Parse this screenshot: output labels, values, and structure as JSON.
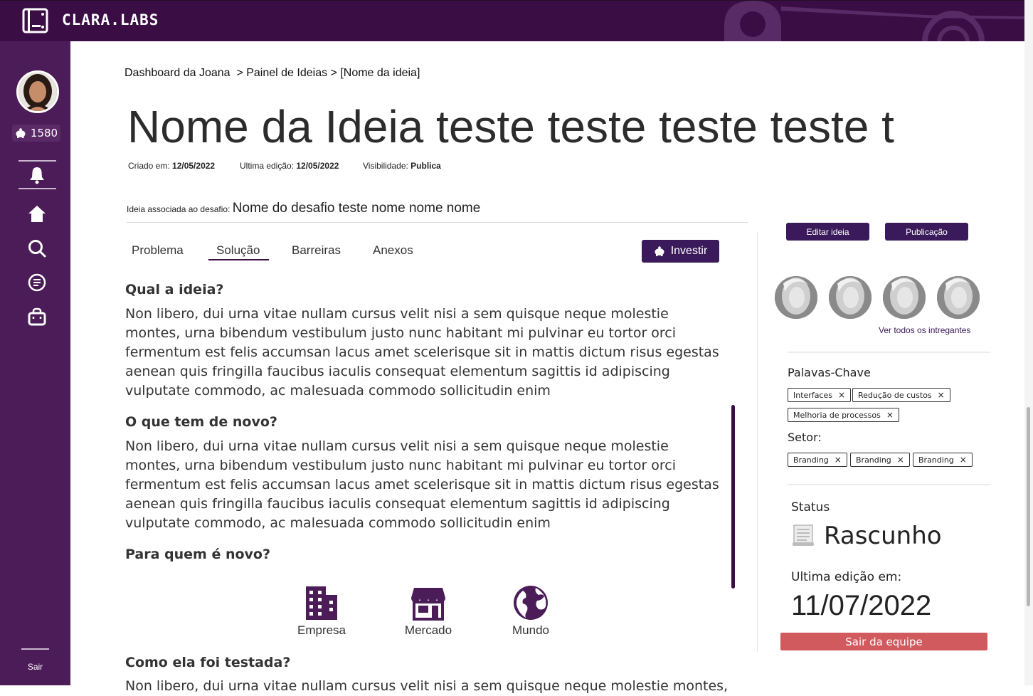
{
  "app": {
    "brand": "CLARA.LABS"
  },
  "sidebar": {
    "coins": "1580",
    "logout_label": "Sair",
    "items": [
      {
        "icon": "bell-icon"
      },
      {
        "icon": "home-icon"
      },
      {
        "icon": "search-icon"
      },
      {
        "icon": "list-icon"
      },
      {
        "icon": "bag-icon"
      }
    ]
  },
  "breadcrumb": "Dashboard da Joana  > Painel de Ideias > [Nome da ideia]",
  "idea": {
    "title": "Nome da Ideia teste teste teste teste t",
    "created_label": "Criado em: ",
    "created_value": "12/05/2022",
    "edited_label": "Ultima edição: ",
    "edited_value": "12/05/2022",
    "visibility_label": "Visibilidade: ",
    "visibility_value": "Publica",
    "challenge_label": "Ideia associada ao desafio: ",
    "challenge_value": "Nome do desafio teste nome nome nome"
  },
  "tabs": [
    {
      "label": "Problema"
    },
    {
      "label": "Solução",
      "active": true
    },
    {
      "label": "Barreiras"
    },
    {
      "label": "Anexos"
    }
  ],
  "invest_label": "Investir",
  "sections": {
    "q1": "Qual a ideia?",
    "p1": "Non libero, dui urna vitae nullam cursus velit nisi a sem quisque neque molestie montes, urna bibendum vestibulum justo nunc habitant mi pulvinar eu tortor orci fermentum est felis accumsan lacus amet scelerisque sit in mattis dictum risus egestas aenean quis fringilla faucibus iaculis consequat elementum sagittis id adipiscing vulputate commodo, ac malesuada commodo sollicitudin enim",
    "q2": "O que tem de novo?",
    "p2": "Non libero, dui urna vitae nullam cursus velit nisi a sem quisque neque molestie montes, urna bibendum vestibulum justo nunc habitant mi pulvinar eu tortor orci fermentum est felis accumsan lacus amet scelerisque sit in mattis dictum risus egestas aenean quis fringilla faucibus iaculis consequat elementum sagittis id adipiscing vulputate commodo, ac malesuada commodo sollicitudin enim",
    "q3": "Para quem é novo?",
    "audience": [
      {
        "label": "Empresa",
        "icon": "building-icon"
      },
      {
        "label": "Mercado",
        "icon": "store-icon"
      },
      {
        "label": "Mundo",
        "icon": "globe-icon"
      }
    ],
    "q4": "Como ela foi testada?",
    "p4": "Non libero, dui urna vitae nullam cursus velit nisi a sem quisque neque molestie montes,"
  },
  "side": {
    "edit_button": "Editar ideia",
    "publish_button": "Publicação",
    "see_all_members": "Ver todos os intregantes",
    "keywords_title": "Palavas-Chave",
    "keywords": [
      "Interfaces",
      "Redução de custos",
      "Melhoria de processos"
    ],
    "sector_title": "Setor:",
    "sectors": [
      "Branding",
      "Branding",
      "Branding"
    ],
    "status_label": "Status",
    "status_value": "Rascunho",
    "last_edit_label": "Ultima edição em:",
    "last_edit_value": "11/07/2022",
    "leave_button": "Sair da equipe"
  },
  "colors": {
    "primary": "#3a0d45",
    "sidebar": "#4b1c57",
    "danger": "#d05a5e"
  }
}
